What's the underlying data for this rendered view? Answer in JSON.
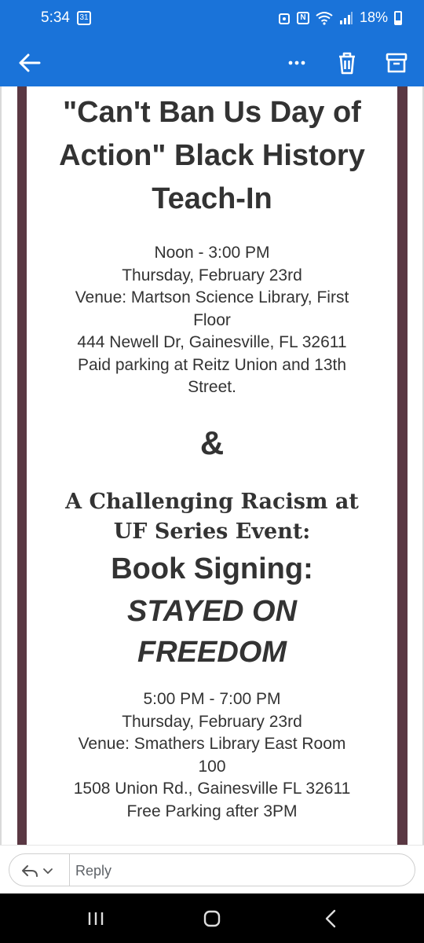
{
  "status": {
    "time": "5:34",
    "calendar_day": "31",
    "battery": "18%",
    "n_badge": "N"
  },
  "appbar": {
    "back": "back-icon",
    "more": "more-icon",
    "delete": "trash-icon",
    "archive": "archive-icon"
  },
  "event1": {
    "title_lines": [
      "\"Can't Ban Us Day of",
      "Action\" Black History",
      "Teach-In"
    ],
    "details": [
      "Noon - 3:00 PM",
      "Thursday, February 23rd",
      "Venue: Martson Science Library, First",
      "Floor",
      "444 Newell Dr, Gainesville, FL 32611",
      "Paid parking at Reitz Union and 13th",
      "Street."
    ]
  },
  "ampersand": "&",
  "event2": {
    "series_lines": [
      "A Challenging Racism at",
      "UF Series Event:"
    ],
    "heading": "Book Signing:",
    "book_lines": [
      "STAYED ON",
      "FREEDOM"
    ],
    "details": [
      "5:00 PM - 7:00 PM",
      "Thursday, February 23rd",
      "Venue: Smathers Library East Room",
      "100",
      "1508 Union Rd., Gainesville FL 32611",
      "Free Parking after 3PM"
    ]
  },
  "reply": {
    "placeholder": "Reply"
  },
  "colors": {
    "appbar": "#1a73d9",
    "frame": "#5a3843",
    "text": "#333333"
  }
}
